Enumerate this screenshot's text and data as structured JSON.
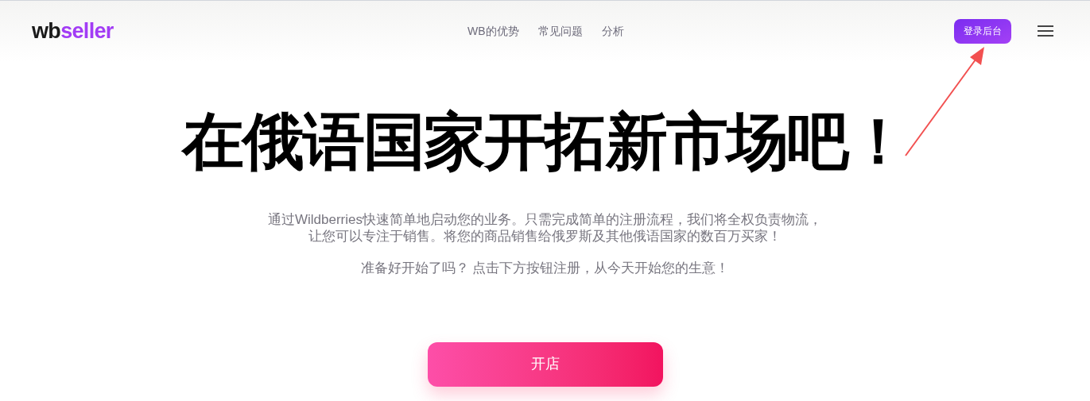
{
  "header": {
    "logo": [
      "wb",
      "seller"
    ],
    "nav": [
      "WB的优势",
      "常见问题",
      "分析"
    ],
    "login_button": "登录后台"
  },
  "hero": {
    "title": "在俄语国家开拓新市场吧！",
    "description": [
      "通过Wildberries快速简单地启动您的业务。只需完成简单的注册流程，我们将全权负责物流，",
      "让您可以专注于销售。将您的商品销售给俄罗斯及其他俄语国家的数百万买家！"
    ],
    "prompt": "准备好开始了吗？ 点击下方按钮注册，从今天开始您的生意！",
    "cta": "开店"
  }
}
